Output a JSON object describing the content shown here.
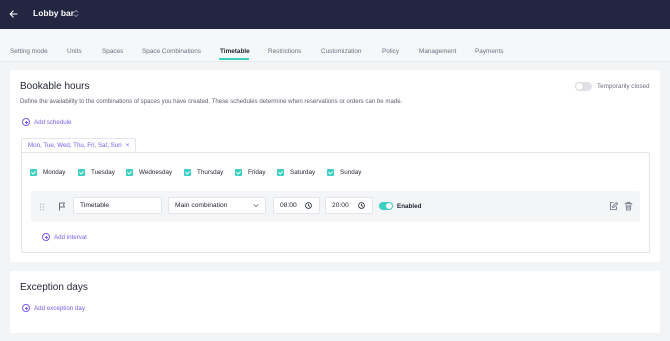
{
  "header": {
    "title": "Lobby bar"
  },
  "tabs": [
    {
      "label": "Setting mode",
      "active": false
    },
    {
      "label": "Units",
      "active": false
    },
    {
      "label": "Spaces",
      "active": false
    },
    {
      "label": "Space Combinations",
      "active": false
    },
    {
      "label": "Timetable",
      "active": true
    },
    {
      "label": "Restrictions",
      "active": false
    },
    {
      "label": "Customization",
      "active": false
    },
    {
      "label": "Policy",
      "active": false
    },
    {
      "label": "Management",
      "active": false
    },
    {
      "label": "Payments",
      "active": false
    }
  ],
  "bookable": {
    "title": "Bookable hours",
    "description": "Define the availability to the combinations of spaces you have created. These schedules determine when reservations or orders can be made.",
    "temporarily_closed_label": "Temporarily closed",
    "temporarily_closed": false,
    "add_schedule_label": "Add schedule",
    "schedule_chip": "Mon, Tue, Wed, Thu, Fri, Sat, Sun",
    "days": [
      {
        "label": "Monday",
        "checked": true
      },
      {
        "label": "Tuesday",
        "checked": true
      },
      {
        "label": "Wednesday",
        "checked": true
      },
      {
        "label": "Thursday",
        "checked": true
      },
      {
        "label": "Friday",
        "checked": true
      },
      {
        "label": "Saturday",
        "checked": true
      },
      {
        "label": "Sunday",
        "checked": true
      }
    ],
    "interval": {
      "name": "Timetable",
      "combination": "Main combination",
      "start": "08:00",
      "end": "20:00",
      "enabled_label": "Enabled",
      "enabled": true
    },
    "add_interval_label": "Add interval"
  },
  "exceptions": {
    "title": "Exception days",
    "add_label": "Add exception day"
  },
  "colors": {
    "header_bg": "#232641",
    "accent_teal": "#3ccfc3",
    "accent_purple": "#7b5cf0"
  }
}
